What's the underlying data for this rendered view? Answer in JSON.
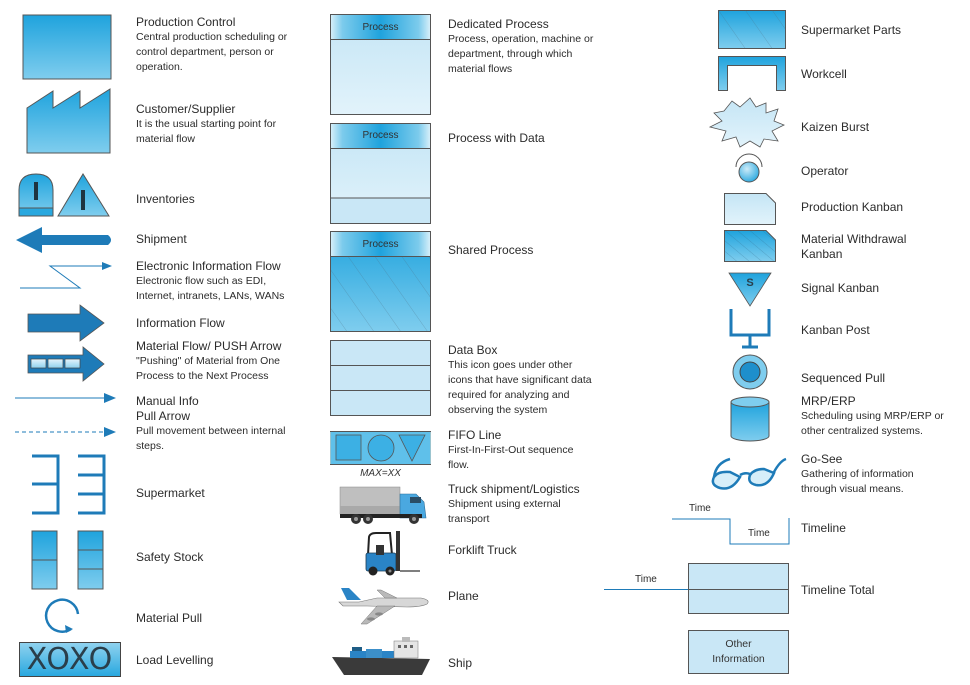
{
  "colors": {
    "blue_dark": "#1e7bb8",
    "blue_mid": "#29a8df",
    "blue_light": "#7ccbec",
    "blue_pale": "#cfe9f7",
    "stroke": "#555555"
  },
  "left_column": [
    {
      "title": "Production Control",
      "desc": [
        "Central production scheduling or",
        "control department, person or",
        "operation."
      ],
      "icon": "production-control-icon"
    },
    {
      "title": "Customer/Supplier",
      "desc": [
        "It is the usual starting point for",
        "material flow"
      ],
      "icon": "factory-icon"
    },
    {
      "title": "Inventories",
      "desc": [],
      "icon": "inventory-icon"
    },
    {
      "title": "Shipment",
      "desc": [],
      "icon": "shipment-arrow-icon"
    },
    {
      "title": "Electronic Information Flow",
      "desc": [
        "Electronic flow such as EDI,",
        "Internet, intranets, LANs, WANs"
      ],
      "icon": "electronic-flow-icon"
    },
    {
      "title": "Information Flow",
      "desc": [],
      "icon": "information-flow-arrow-icon"
    },
    {
      "title": "Material Flow/ PUSH Arrow",
      "desc": [
        "\"Pushing\" of Material from One",
        "Process to the Next Process"
      ],
      "icon": "push-arrow-icon"
    },
    {
      "title": "Manual Info",
      "desc": [],
      "icon": "manual-info-arrow-icon"
    },
    {
      "title": "Pull Arrow",
      "desc": [
        "Pull movement between internal",
        "steps."
      ],
      "icon": "pull-arrow-icon"
    },
    {
      "title": "Supermarket",
      "desc": [],
      "icon": "supermarket-icon"
    },
    {
      "title": "Safety Stock",
      "desc": [],
      "icon": "safety-stock-icon"
    },
    {
      "title": "Material Pull",
      "desc": [],
      "icon": "material-pull-icon"
    },
    {
      "title": "Load Levelling",
      "desc": [],
      "icon": "load-levelling-icon",
      "icon_text": "XOXO"
    }
  ],
  "middle_column": [
    {
      "title": "Dedicated Process",
      "desc": [
        "Process, operation, machine or",
        "department, through which",
        "material flows"
      ],
      "icon": "dedicated-process-icon",
      "icon_text": "Process"
    },
    {
      "title": "Process with Data",
      "desc": [],
      "icon": "process-with-data-icon",
      "icon_text": "Process"
    },
    {
      "title": "Shared Process",
      "desc": [],
      "icon": "shared-process-icon",
      "icon_text": "Process"
    },
    {
      "title": "Data Box",
      "desc": [
        "This icon goes under other",
        "icons that have significant data",
        "required for analyzing and",
        "observing the system"
      ],
      "icon": "data-box-icon"
    },
    {
      "title": "FIFO Line",
      "desc": [
        "First-In-First-Out sequence",
        "flow."
      ],
      "icon": "fifo-line-icon",
      "icon_text": "MAX=XX"
    },
    {
      "title": "Truck shipment/Logistics",
      "desc": [
        "Shipment using external",
        "transport"
      ],
      "icon": "truck-icon"
    },
    {
      "title": "Forklift Truck",
      "desc": [],
      "icon": "forklift-icon"
    },
    {
      "title": "Plane",
      "desc": [],
      "icon": "plane-icon"
    },
    {
      "title": "Ship",
      "desc": [],
      "icon": "ship-icon"
    }
  ],
  "right_column": [
    {
      "title": "Supermarket Parts",
      "desc": [],
      "icon": "supermarket-parts-icon"
    },
    {
      "title": "Workcell",
      "desc": [],
      "icon": "workcell-icon"
    },
    {
      "title": "Kaizen Burst",
      "desc": [],
      "icon": "kaizen-burst-icon"
    },
    {
      "title": "Operator",
      "desc": [],
      "icon": "operator-icon"
    },
    {
      "title": "Production Kanban",
      "desc": [],
      "icon": "production-kanban-icon"
    },
    {
      "title": "Material Withdrawal",
      "desc": [
        "Kanban"
      ],
      "icon": "withdrawal-kanban-icon"
    },
    {
      "title": "Signal Kanban",
      "desc": [],
      "icon": "signal-kanban-icon",
      "icon_text": "S"
    },
    {
      "title": "Kanban Post",
      "desc": [],
      "icon": "kanban-post-icon"
    },
    {
      "title": "Sequenced Pull",
      "desc": [],
      "icon": "sequenced-pull-icon"
    },
    {
      "title": "MRP/ERP",
      "desc": [
        "Scheduling using MRP/ERP or",
        "other centralized systems."
      ],
      "icon": "database-icon"
    },
    {
      "title": "Go-See",
      "desc": [
        "Gathering of information",
        "through visual means."
      ],
      "icon": "glasses-icon"
    },
    {
      "title": "Timeline",
      "desc": [],
      "icon": "timeline-icon",
      "icon_labels": [
        "Time",
        "Time"
      ]
    },
    {
      "title": "Timeline Total",
      "desc": [],
      "icon": "timeline-total-icon",
      "icon_labels": [
        "Time"
      ]
    },
    {
      "title": "",
      "desc": [],
      "icon": "other-information-icon",
      "icon_text": [
        "Other",
        "Information"
      ]
    }
  ]
}
